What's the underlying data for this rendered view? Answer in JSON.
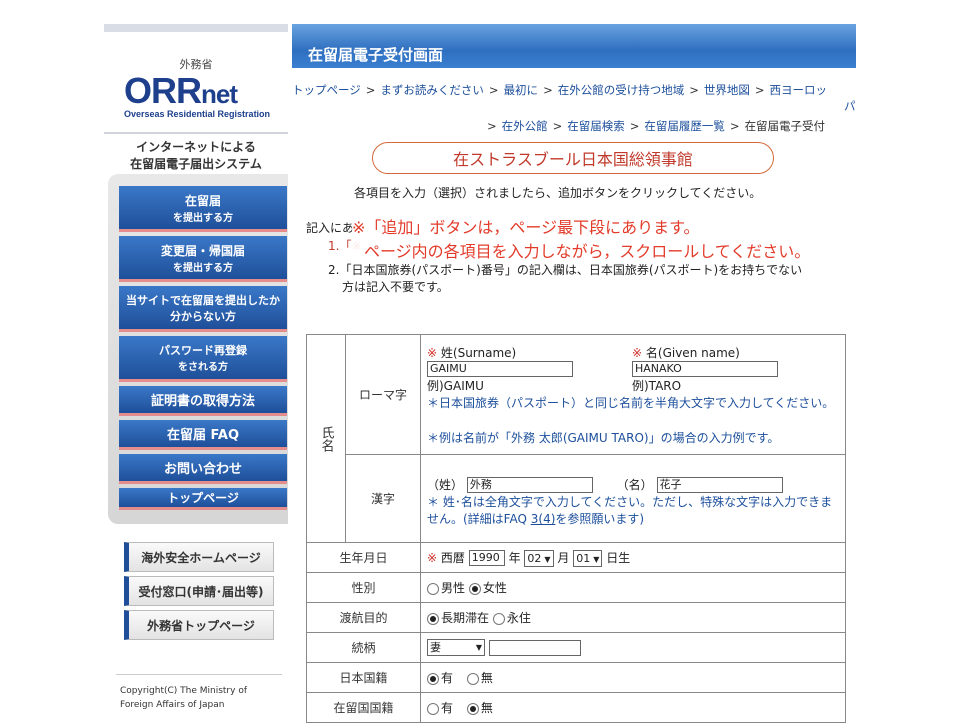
{
  "sidebar": {
    "ministry": "外務省",
    "brand_main": "ORR",
    "brand_suffix": "net",
    "brand_sub": "Overseas Residential Registration",
    "tagline1": "インターネットによる",
    "tagline2": "在留届電子届出システム",
    "menu": [
      {
        "main": "在留届",
        "sub": "を提出する方"
      },
      {
        "main": "変更届・帰国届",
        "sub": "を提出する方"
      },
      {
        "main": "当サイトで在留届を提出したか",
        "sub": "分からない方"
      },
      {
        "main": "パスワード再登録",
        "sub": "をされる方"
      },
      {
        "main": "証明書の取得方法",
        "sub": ""
      },
      {
        "main": "在留届 FAQ",
        "sub": ""
      },
      {
        "main": "お問い合わせ",
        "sub": ""
      },
      {
        "main": "トップページ",
        "sub": ""
      }
    ],
    "links": [
      "海外安全ホームページ",
      "受付窓口(申請･届出等)",
      "外務省トップページ"
    ],
    "copyright1": "Copyright(C)  The Ministry of",
    "copyright2": "Foreign Affairs of Japan"
  },
  "header": {
    "title": "在留届電子受付画面"
  },
  "breadcrumb": {
    "row1": [
      "トップページ",
      "まずお読みください",
      "最初に",
      "在外公館の受け持つ地域",
      "世界地図",
      "西ヨーロッ"
    ],
    "row1_wrap": "パ",
    "row2": [
      "在外公館",
      "在留届検索",
      "在留届履歴一覧"
    ],
    "current": "在留届電子受付",
    "sep": ">"
  },
  "consulate": "在ストラスブール日本国総領事館",
  "intro": "各項目を入力（選択）されましたら、追加ボタンをクリックしてください。",
  "notes": {
    "n1": "記入にあ",
    "n2": "1.「※",
    "n3": "2.「日本国旅券(パスポート)番号」の記入欄は、日本国旅券(パスポート)をお持ちでない",
    "n3b": "方は記入不要です。"
  },
  "alert": {
    "line1": "※「追加」ボタンは，ページ最下段にあります。",
    "line2": "ページ内の各項目を入力しながら，スクロールしてください。"
  },
  "form": {
    "name_group": "氏名",
    "romaji_label": "ローマ字",
    "req": "※",
    "surname_label": "姓(Surname)",
    "given_label": "名(Given name)",
    "surname_value": "GAIMU",
    "given_value": "HANAKO",
    "surname_example": "例)GAIMU",
    "given_example": "例)TARO",
    "romaji_note1": "＊日本国旅券（パスポート）と同じ名前を半角大文字で入力してください。",
    "romaji_note2": "＊例は名前が「外務 太郎(GAIMU TARO)」の場合の入力例です。",
    "kanji_label": "漢字",
    "kanji_sei_label": "（姓）",
    "kanji_mei_label": "（名）",
    "kanji_sei_value": "外務",
    "kanji_mei_value": "花子",
    "kanji_note1": "＊ 姓･名は全角文字で入力してください。ただし、特殊な文字は入力できま",
    "kanji_note2a": "せん。(詳細はFAQ ",
    "kanji_note2link": "3(4)",
    "kanji_note2b": "を参照願います)",
    "birth_label": "生年月日",
    "era": "西暦",
    "year": "1990",
    "year_unit": "年",
    "month": "02",
    "month_unit": "月",
    "day": "01",
    "day_unit": "日生",
    "gender_label": "性別",
    "gender_male": "男性",
    "gender_female": "女性",
    "purpose_label": "渡航目的",
    "purpose_long": "長期滞在",
    "purpose_perm": "永住",
    "relation_label": "続柄",
    "relation_value": "妻",
    "jp_nat_label": "日本国籍",
    "jp_nat_yes": "有",
    "jp_nat_no": "無",
    "res_nat_label": "在留国国籍",
    "res_nat_yes": "有",
    "res_nat_no": "無"
  }
}
